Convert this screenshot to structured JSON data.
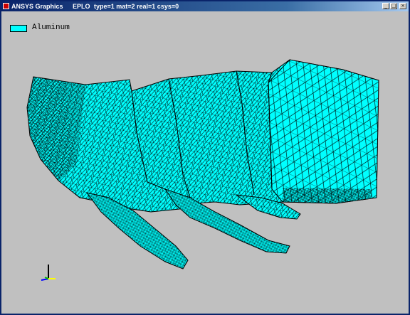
{
  "window": {
    "title": "ANSYS Graphics",
    "command": "EPLO",
    "info": "type=1 mat=2 real=1 csys=0"
  },
  "controls": {
    "minimize_glyph": "_",
    "maximize_glyph": "□",
    "close_glyph": "×"
  },
  "legend": {
    "label": "Aluminum",
    "color": "#00ffff"
  },
  "colors": {
    "background": "#c0c0c0",
    "mesh_fill": "#00ffff",
    "mesh_lines": "#000000",
    "titlebar": "#0a246a"
  },
  "icons": {
    "app": "ansys-app-icon",
    "triad": "coordinate-triad-icon"
  }
}
